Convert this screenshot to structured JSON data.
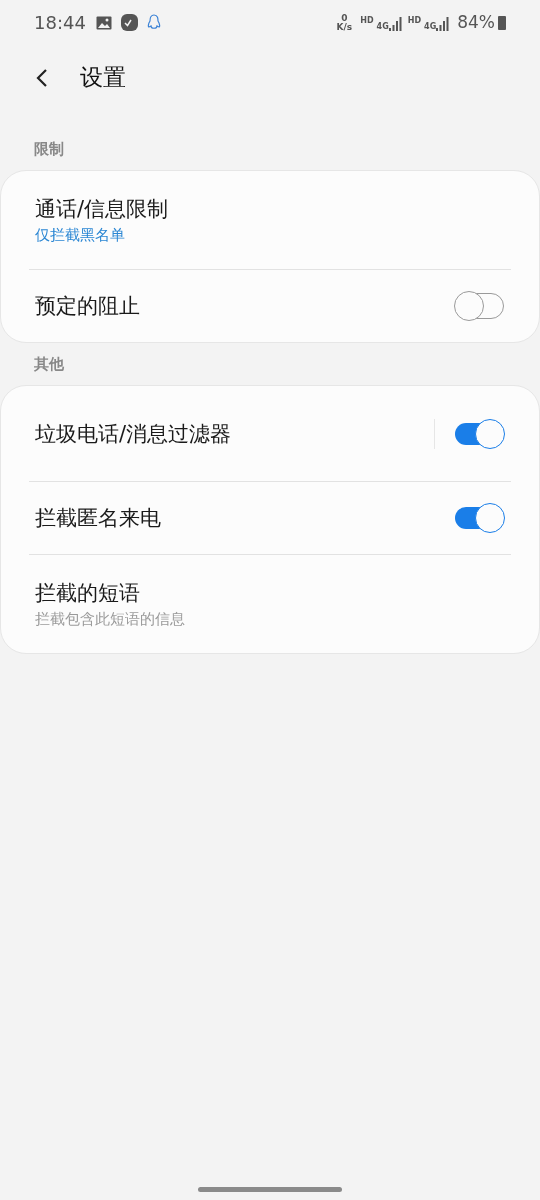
{
  "status_bar": {
    "time": "18:44",
    "speed_value": "0",
    "speed_unit": "K/s",
    "sims": [
      {
        "hd": "HD",
        "network": "4G"
      },
      {
        "hd": "HD",
        "network": "4G"
      }
    ],
    "battery": "84%"
  },
  "header": {
    "title": "设置"
  },
  "sections": [
    {
      "label": "限制",
      "items": [
        {
          "kind": "link",
          "title": "通话/信息限制",
          "subtitle": "仅拦截黑名单",
          "accent": true
        },
        {
          "kind": "switch",
          "title": "预定的阻止",
          "on": false,
          "split": false
        }
      ]
    },
    {
      "label": "其他",
      "items": [
        {
          "kind": "switch",
          "title": "垃圾电话/消息过滤器",
          "on": true,
          "split": true
        },
        {
          "kind": "switch",
          "title": "拦截匿名来电",
          "on": true,
          "split": false
        },
        {
          "kind": "link",
          "title": "拦截的短语",
          "subtitle": "拦截包含此短语的信息",
          "accent": false
        }
      ]
    }
  ]
}
